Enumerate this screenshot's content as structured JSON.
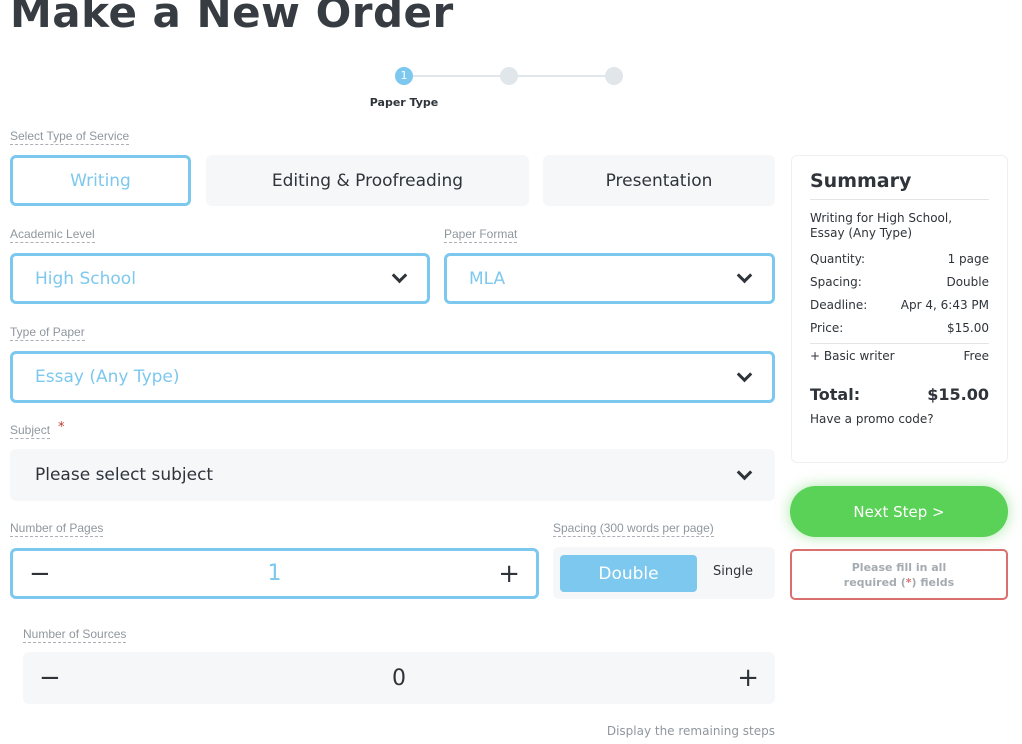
{
  "title": "Make a New Order",
  "stepper": {
    "steps": [
      {
        "number": "1",
        "label": "Paper Type",
        "active": true
      },
      {
        "active": false
      },
      {
        "active": false
      }
    ]
  },
  "service": {
    "label": "Select Type of Service",
    "options": [
      "Writing",
      "Editing & Proofreading",
      "Presentation"
    ],
    "selected": "Writing"
  },
  "academic_level": {
    "label": "Academic Level",
    "value": "High School"
  },
  "paper_format": {
    "label": "Paper Format",
    "value": "MLA"
  },
  "paper_type": {
    "label": "Type of Paper",
    "value": "Essay (Any Type)"
  },
  "subject": {
    "label": "Subject",
    "required": "*",
    "placeholder": "Please select subject"
  },
  "pages": {
    "label": "Number of Pages",
    "value": "1",
    "minus": "−",
    "plus": "+"
  },
  "spacing": {
    "label": "Spacing (300 words per page)",
    "options": [
      "Double",
      "Single"
    ],
    "selected": "Double"
  },
  "sources": {
    "label": "Number of Sources",
    "value": "0",
    "minus": "−",
    "plus": "+"
  },
  "remaining_link": "Display the remaining steps",
  "summary": {
    "title": "Summary",
    "description": "Writing for High School, Essay (Any Type)",
    "rows": [
      {
        "k": "Quantity:",
        "v": "1 page"
      },
      {
        "k": "Spacing:",
        "v": "Double"
      },
      {
        "k": "Deadline:",
        "v": "Apr 4, 6:43 PM"
      },
      {
        "k": "Price:",
        "v": "$15.00"
      }
    ],
    "extra": {
      "k": "+ Basic writer",
      "v": "Free"
    },
    "total_label": "Total:",
    "total": "$15.00",
    "promo": "Have a promo code?"
  },
  "next_button": "Next Step >",
  "warning": {
    "line1": "Please fill in all",
    "line2_pre": "required (",
    "star": "*",
    "line2_post": ") fields"
  },
  "colors": {
    "accent": "#7dc8ee",
    "green": "#5ad157",
    "error": "#d9706e"
  }
}
